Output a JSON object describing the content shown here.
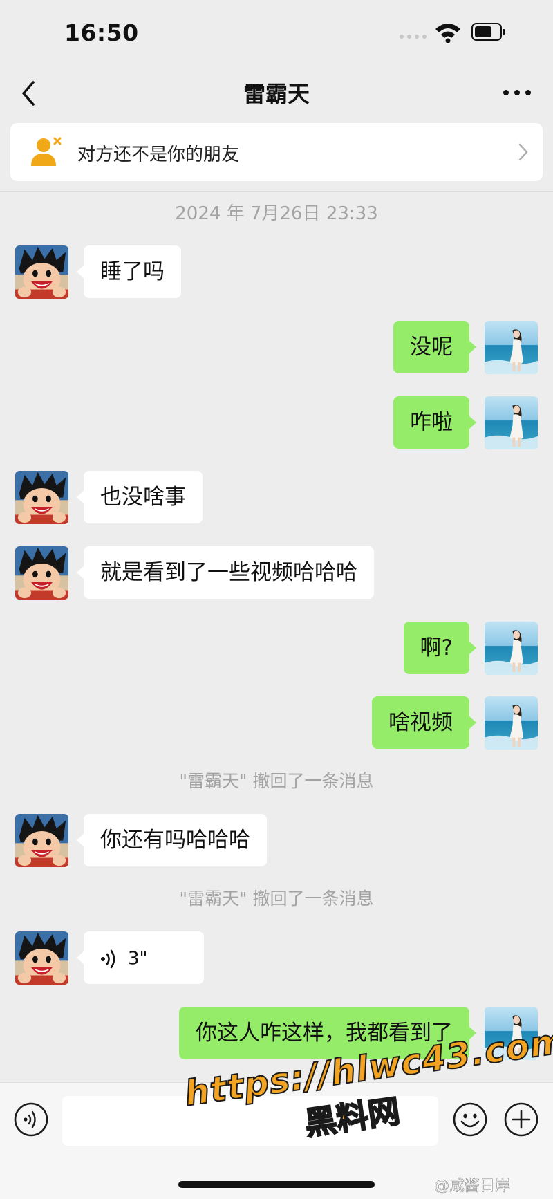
{
  "status_bar": {
    "time": "16:50"
  },
  "header": {
    "title": "雷霸天"
  },
  "friend_banner": {
    "text": "对方还不是你的朋友"
  },
  "chat": {
    "timestamp": "2024 年 7月26日 23:33",
    "messages": [
      {
        "side": "left",
        "text": "睡了吗"
      },
      {
        "side": "right",
        "text": "没呢"
      },
      {
        "side": "right",
        "text": "咋啦"
      },
      {
        "side": "left",
        "text": "也没啥事"
      },
      {
        "side": "left",
        "text": "就是看到了一些视频哈哈哈"
      },
      {
        "side": "right",
        "text": "啊?"
      },
      {
        "side": "right",
        "text": "啥视频"
      },
      {
        "side": "system",
        "text": "\"雷霸天\" 撤回了一条消息"
      },
      {
        "side": "left",
        "text": "你还有吗哈哈哈"
      },
      {
        "side": "system",
        "text": "\"雷霸天\" 撤回了一条消息"
      },
      {
        "side": "left",
        "type": "voice",
        "duration": "3\""
      },
      {
        "side": "right",
        "text": "你这人咋这样，我都看到了"
      }
    ]
  },
  "input_bar": {
    "voice_icon": "voice-icon",
    "emoji_icon": "emoji-icon",
    "add_icon": "plus-icon"
  },
  "watermark": {
    "line1": "https://hlwc43.com",
    "line2": "黑料网"
  },
  "weibo_credit": "@咸酱日岸",
  "colors": {
    "background": "#ededed",
    "sent_bubble": "#95ec69",
    "received_bubble": "#ffffff",
    "system_text": "#a3a3a3"
  }
}
